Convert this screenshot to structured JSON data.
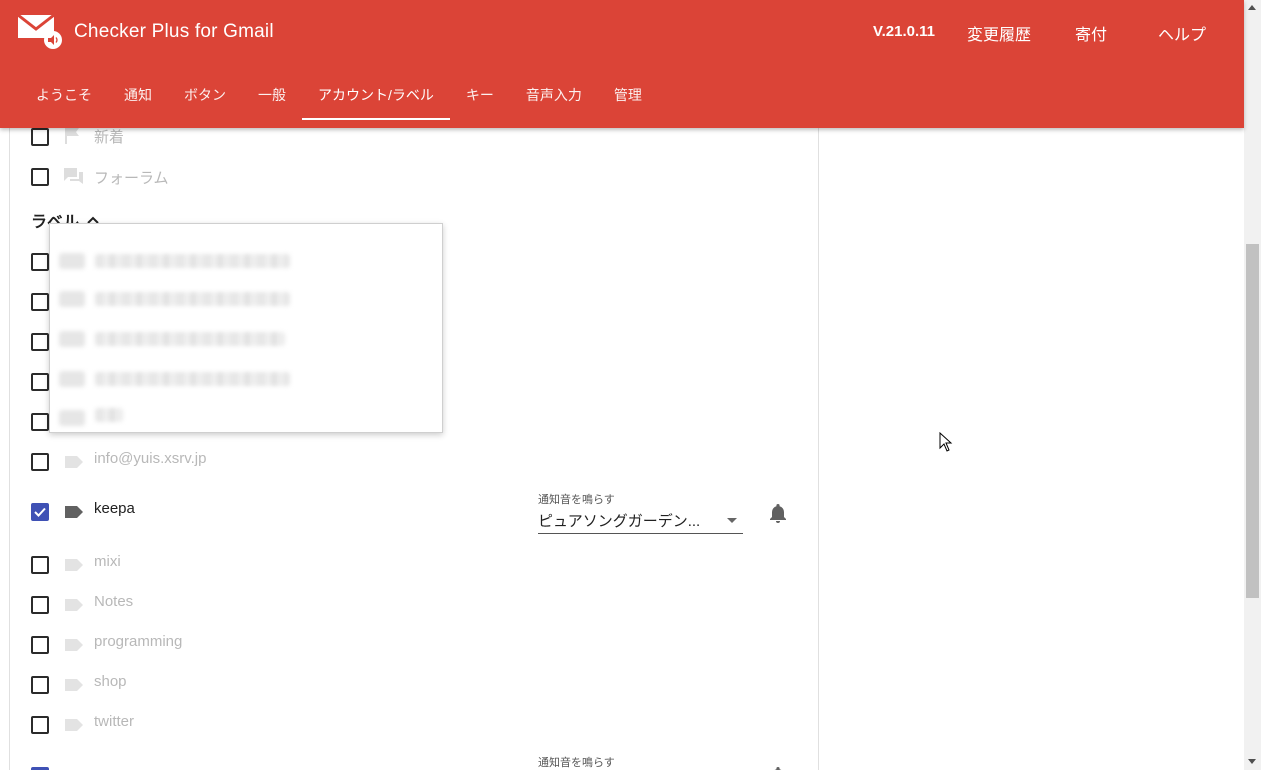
{
  "header": {
    "app_title": "Checker Plus for Gmail",
    "version": "V.21.0.11",
    "links": {
      "history": "変更履歴",
      "donate": "寄付",
      "help": "ヘルプ"
    },
    "tabs": [
      {
        "label": "ようこそ"
      },
      {
        "label": "通知"
      },
      {
        "label": "ボタン"
      },
      {
        "label": "一般"
      },
      {
        "label": "アカウント/ラベル",
        "active": true
      },
      {
        "label": "キー"
      },
      {
        "label": "音声入力"
      },
      {
        "label": "管理"
      }
    ],
    "brand_color": "#db4437",
    "logo_icon": "gmail-envelope-speaker-icon"
  },
  "categories": [
    {
      "label": "新着",
      "icon": "flag-icon",
      "checked": false
    },
    {
      "label": "フォーラム",
      "icon": "forum-icon",
      "checked": false
    }
  ],
  "labels_section": {
    "title": "ラベル",
    "toggle_icon": "chevron-up-icon"
  },
  "labels": [
    {
      "label": "info@yuis.xsrv.jp",
      "checked": false
    },
    {
      "label": "keepa",
      "checked": true
    },
    {
      "label": "mixi",
      "checked": false
    },
    {
      "label": "Notes",
      "checked": false
    },
    {
      "label": "programming",
      "checked": false
    },
    {
      "label": "shop",
      "checked": false
    },
    {
      "label": "twitter",
      "checked": false
    }
  ],
  "sound_setting": {
    "label": "通知音を鳴らす",
    "value": "ピュアソングガーデン...",
    "bell_icon": "bell-icon"
  },
  "checkbox_color": "#3f51b5"
}
